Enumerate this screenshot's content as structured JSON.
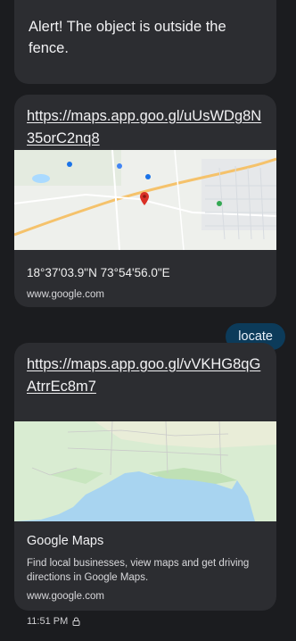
{
  "messages": {
    "alert_text": "Alert!  The object is outside the fence.",
    "card1": {
      "link": "https://maps.app.goo.gl/uUsWDg8N35orC2nq8",
      "coords": "18°37'03.9\"N 73°54'56.0\"E",
      "domain": "www.google.com"
    },
    "locate_label": "locate",
    "card2": {
      "link": "https://maps.app.goo.gl/vVKHG8qGAtrrEc8m7",
      "title": "Google Maps",
      "description": "Find local businesses, view maps and get driving directions in Google Maps.",
      "domain": "www.google.com"
    },
    "timestamp": "11:51 PM"
  },
  "icons": {
    "lock": "lock-icon",
    "map_pin": "map-pin-icon"
  },
  "colors": {
    "background": "#1b1c1f",
    "bubble": "#2c2d31",
    "sent_bubble": "#0c3b5a",
    "pin": "#d93025"
  }
}
